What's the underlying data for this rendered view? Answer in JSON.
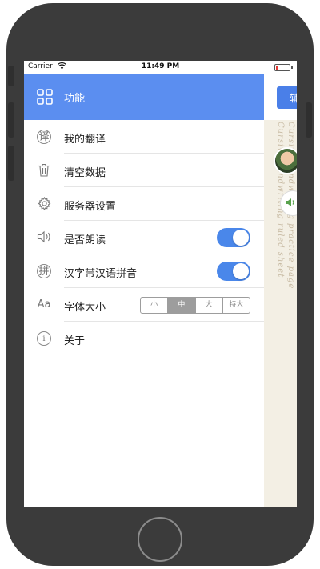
{
  "status_bar": {
    "carrier": "Carrier",
    "time": "11:49 PM",
    "battery_color": "#e53935"
  },
  "header": {
    "icon": "grid-icon",
    "title": "功能",
    "background_color": "#5b8ef0"
  },
  "side_panel": {
    "button_label": "辅",
    "button_color": "#4a7fe8",
    "avatar": "child-avatar",
    "speaker_icon": "speaker-icon",
    "faint_text_1": "Cursive handwriting ruled sheet",
    "faint_text_2": "Cursive handwriting practice page"
  },
  "menu": {
    "items": [
      {
        "icon": "translate-icon",
        "label": "我的翻译"
      },
      {
        "icon": "trash-icon",
        "label": "清空数据"
      },
      {
        "icon": "gear-icon",
        "label": "服务器设置"
      },
      {
        "icon": "speaker-icon",
        "label": "是否朗读",
        "toggle": true
      },
      {
        "icon": "pinyin-icon",
        "label": "汉字带汉语拼音",
        "toggle": true
      },
      {
        "icon": "font-icon",
        "label": "字体大小",
        "segmented": [
          "小",
          "中",
          "大",
          "特大"
        ],
        "selected": "中"
      },
      {
        "icon": "info-icon",
        "label": "关于"
      }
    ]
  },
  "icon_glyphs": {
    "translate": "译",
    "pinyin": "拼",
    "font": "Aa",
    "info": "i",
    "speaker": "🔈",
    "right_button": "辅"
  },
  "accent_color": "#4a87ea"
}
